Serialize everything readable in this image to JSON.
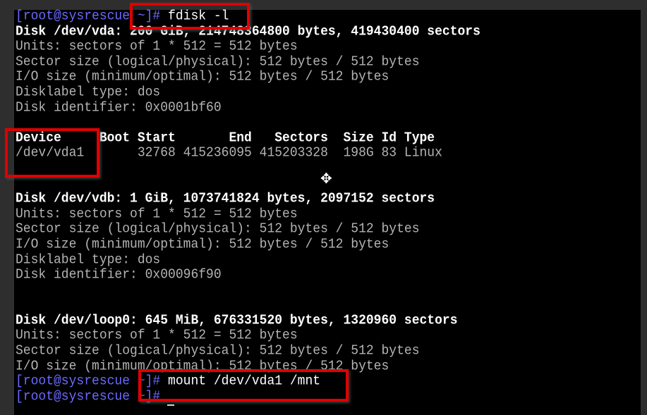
{
  "prompt": "[root@sysrescue ~]#",
  "commands": {
    "fdisk": " fdisk -l",
    "mount": " mount /dev/vda1 /mnt",
    "empty": " "
  },
  "disk_vda": {
    "header": "Disk /dev/vda: 200 GiB, 214748364800 bytes, 419430400 sectors",
    "units": "Units: sectors of 1 * 512 = 512 bytes",
    "sector_size": "Sector size (logical/physical): 512 bytes / 512 bytes",
    "io_size": "I/O size (minimum/optimal): 512 bytes / 512 bytes",
    "label": "Disklabel type: dos",
    "identifier": "Disk identifier: 0x0001bf60",
    "table_header": "Device     Boot Start       End   Sectors  Size Id Type",
    "table_row": "/dev/vda1       32768 415236095 415203328  198G 83 Linux"
  },
  "disk_vdb": {
    "header": "Disk /dev/vdb: 1 GiB, 1073741824 bytes, 2097152 sectors",
    "units": "Units: sectors of 1 * 512 = 512 bytes",
    "sector_size": "Sector size (logical/physical): 512 bytes / 512 bytes",
    "io_size": "I/O size (minimum/optimal): 512 bytes / 512 bytes",
    "label": "Disklabel type: dos",
    "identifier": "Disk identifier: 0x00096f90"
  },
  "disk_loop0": {
    "header": "Disk /dev/loop0: 645 MiB, 676331520 bytes, 1320960 sectors",
    "units": "Units: sectors of 1 * 512 = 512 bytes",
    "sector_size": "Sector size (logical/physical): 512 bytes / 512 bytes",
    "io_size": "I/O size (minimum/optimal): 512 bytes / 512 bytes"
  },
  "colors": {
    "highlight_box": "#e00000",
    "prompt": "#6a6aff",
    "background": "#000000"
  },
  "icons": {
    "pointer": "move-cursor-icon"
  }
}
